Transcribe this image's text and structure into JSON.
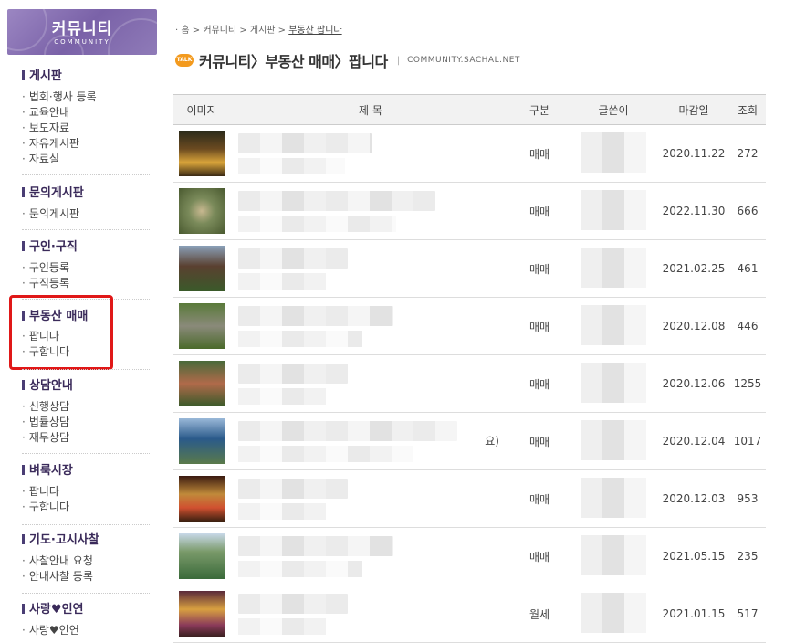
{
  "sidebar": {
    "logo_title": "커뮤니티",
    "logo_subtitle": "COMMUNITY",
    "groups": [
      {
        "title": "게시판",
        "items": [
          "법회·행사 등록",
          "교육안내",
          "보도자료",
          "자유게시판",
          "자료실"
        ]
      },
      {
        "title": "문의게시판",
        "items": [
          "문의게시판"
        ]
      },
      {
        "title": "구인·구직",
        "items": [
          "구인등록",
          "구직등록"
        ]
      },
      {
        "title": "부동산 매매",
        "items": [
          "팝니다",
          "구합니다"
        ]
      },
      {
        "title": "상담안내",
        "items": [
          "신행상담",
          "법률상담",
          "재무상담"
        ]
      },
      {
        "title": "벼룩시장",
        "items": [
          "팝니다",
          "구합니다"
        ]
      },
      {
        "title": "기도·고시사찰",
        "items": [
          "사찰안내 요청",
          "안내사찰 등록"
        ]
      },
      {
        "title": "사랑♥인연",
        "items": [
          "사랑♥인연"
        ]
      }
    ]
  },
  "breadcrumb": {
    "home_icon": "home-icon",
    "parts": [
      "홈",
      "커뮤니티",
      "게시판"
    ],
    "current": "부동산 팝니다"
  },
  "heading": {
    "badge": "TALK",
    "title": "커뮤니티〉부동산 매매〉팝니다",
    "separator": "|",
    "domain": "COMMUNITY.SACHAL.NET"
  },
  "table": {
    "headers": [
      "이미지",
      "제 목",
      "구분",
      "글쓴이",
      "마감일",
      "조회"
    ],
    "rows": [
      {
        "category": "매매",
        "date": "2020.11.22",
        "views": "272",
        "title_suffix": ""
      },
      {
        "category": "매매",
        "date": "2022.11.30",
        "views": "666",
        "title_suffix": ""
      },
      {
        "category": "매매",
        "date": "2021.02.25",
        "views": "461",
        "title_suffix": ""
      },
      {
        "category": "매매",
        "date": "2020.12.08",
        "views": "446",
        "title_suffix": ""
      },
      {
        "category": "매매",
        "date": "2020.12.06",
        "views": "1255",
        "title_suffix": ""
      },
      {
        "category": "매매",
        "date": "2020.12.04",
        "views": "1017",
        "title_suffix": "요)"
      },
      {
        "category": "매매",
        "date": "2020.12.03",
        "views": "953",
        "title_suffix": ""
      },
      {
        "category": "매매",
        "date": "2021.05.15",
        "views": "235",
        "title_suffix": ""
      },
      {
        "category": "월세",
        "date": "2021.01.15",
        "views": "517",
        "title_suffix": ""
      }
    ]
  },
  "colors": {
    "accent": "#4a3d74",
    "highlight": "#e01818",
    "talk_badge": "#f39a1e"
  }
}
